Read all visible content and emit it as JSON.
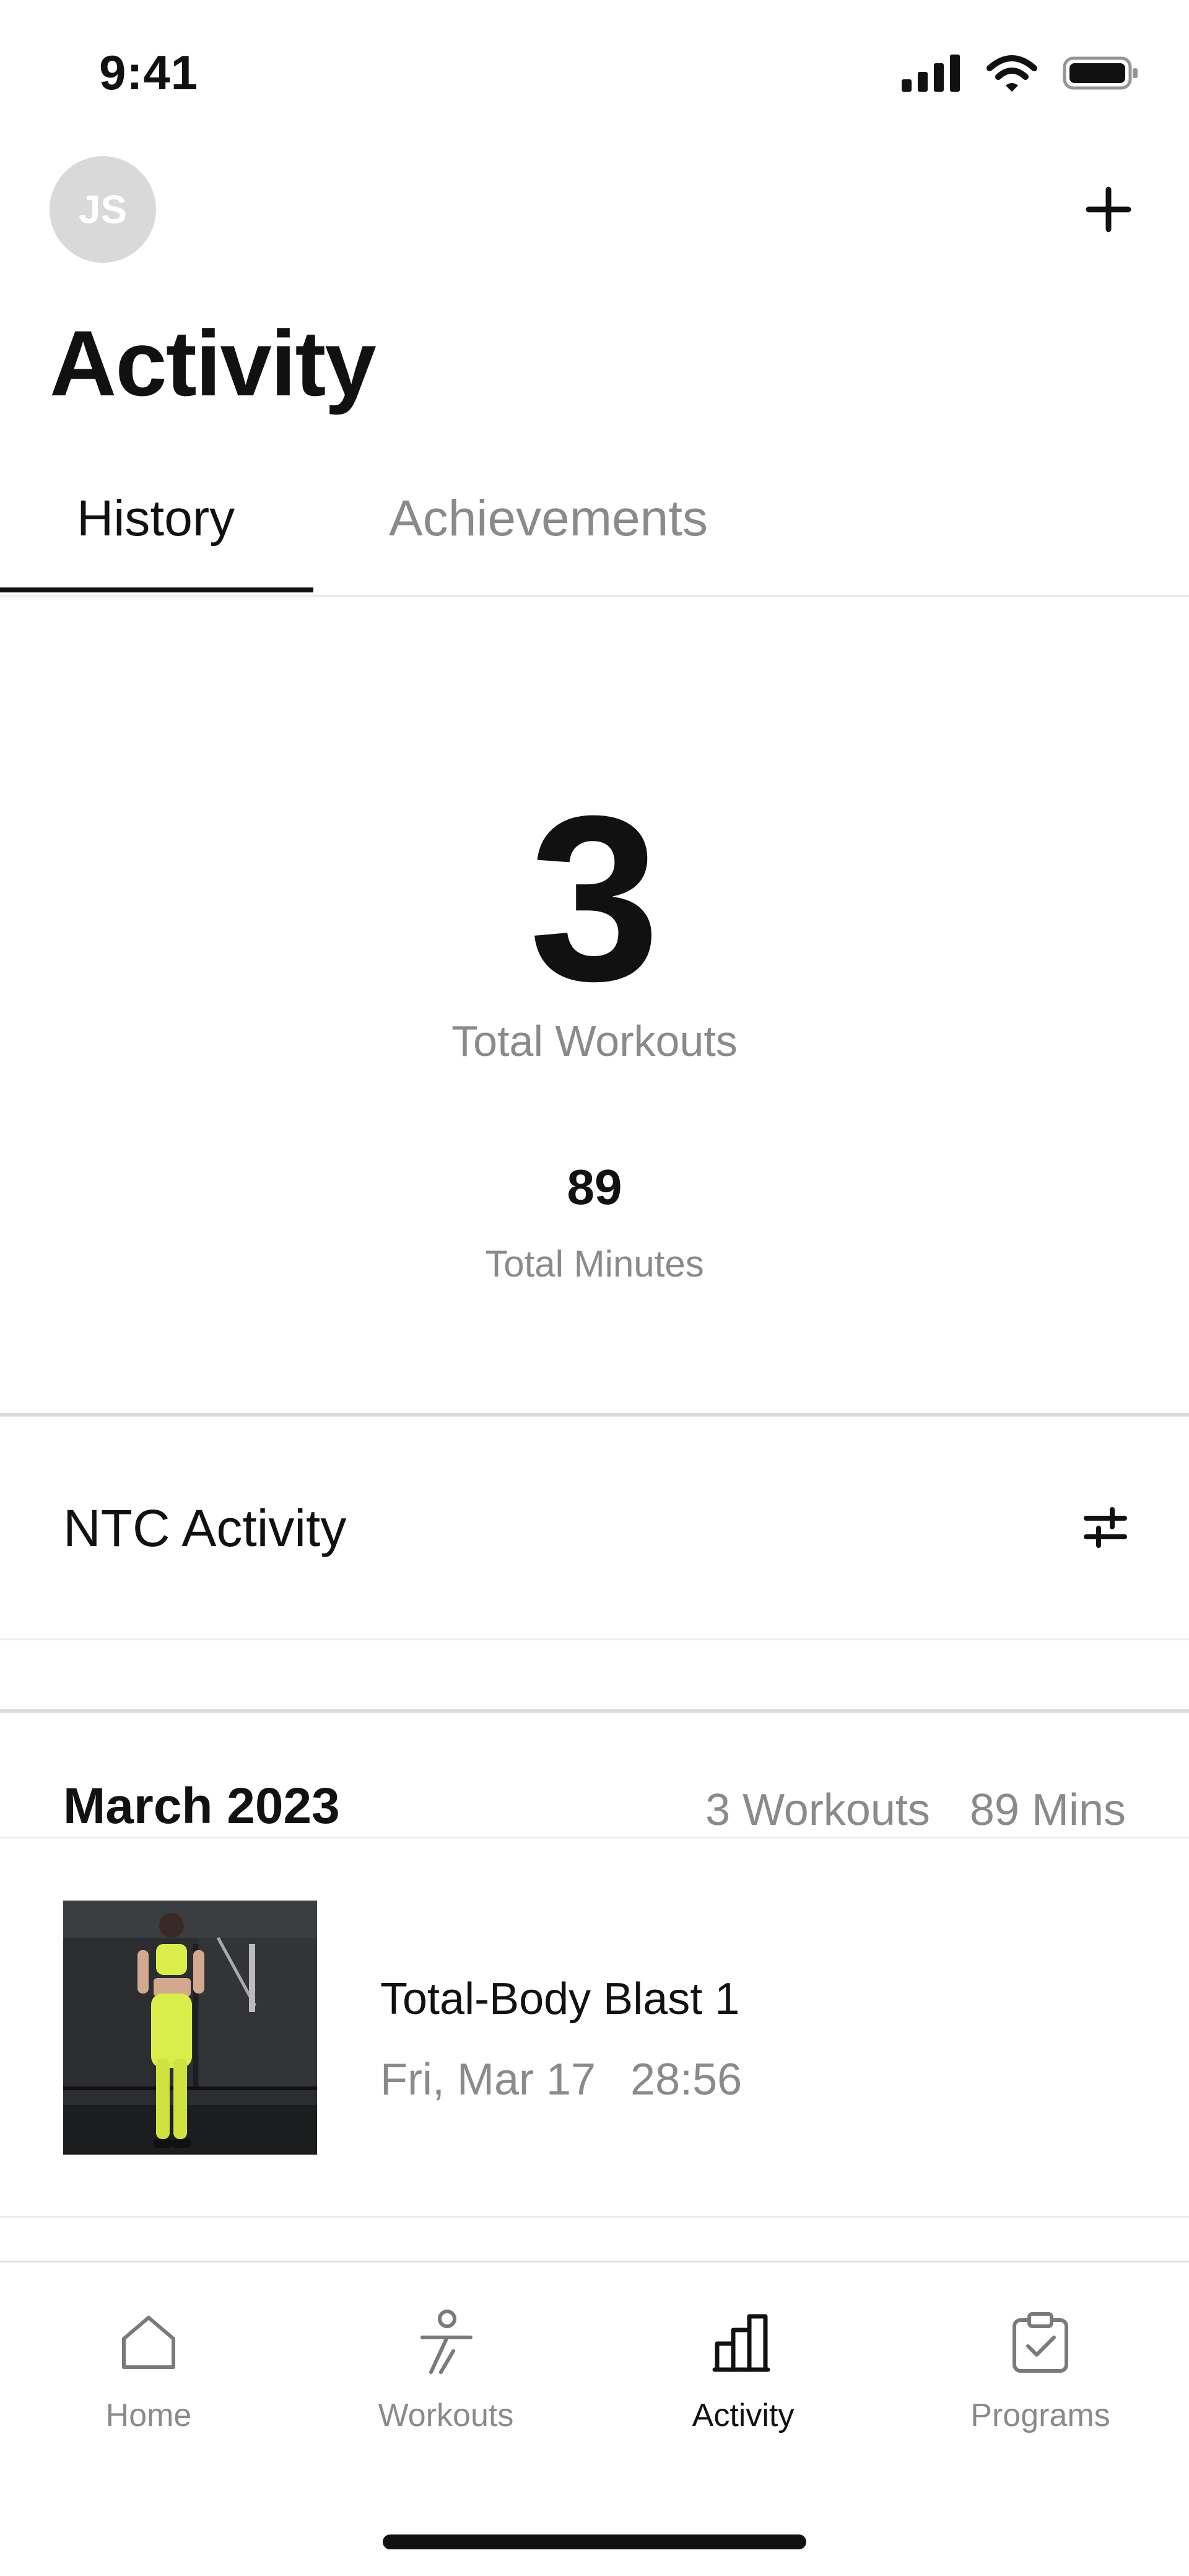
{
  "status_bar": {
    "time": "9:41"
  },
  "header": {
    "avatar_initials": "JS",
    "title": "Activity"
  },
  "tabs": [
    {
      "label": "History",
      "active": true
    },
    {
      "label": "Achievements",
      "active": false
    }
  ],
  "stats": {
    "total_workouts": "3",
    "total_workouts_label": "Total Workouts",
    "total_minutes": "89",
    "total_minutes_label": "Total Minutes"
  },
  "ntc": {
    "title": "NTC Activity"
  },
  "month": {
    "title": "March 2023",
    "workouts": "3 Workouts",
    "minutes": "89 Mins"
  },
  "workouts": [
    {
      "name": "Total-Body Blast 1",
      "date": "Fri, Mar 17",
      "duration": "28:56"
    }
  ],
  "nav": [
    {
      "label": "Home",
      "icon": "home-icon"
    },
    {
      "label": "Workouts",
      "icon": "runner-icon"
    },
    {
      "label": "Activity",
      "icon": "bar-chart-icon",
      "active": true
    },
    {
      "label": "Programs",
      "icon": "clipboard-check-icon"
    }
  ],
  "colors": {
    "text": "#111111",
    "muted": "#8a8a8a",
    "avatar_bg": "#d9d9d9",
    "thumb_outfit": "#d9ee4a"
  }
}
